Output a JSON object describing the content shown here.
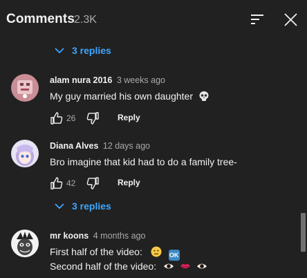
{
  "header": {
    "title": "Comments",
    "count": "2.3K",
    "sort_icon": "sort-icon",
    "close_icon": "close-icon"
  },
  "threads": [
    {
      "replies_label": "3 replies"
    },
    {
      "author": "alam nura 2016",
      "time": "3 weeks ago",
      "text": "My guy married his own daughter",
      "emoji": "skull",
      "likes": "26",
      "reply_label": "Reply"
    },
    {
      "author": "Diana Alves",
      "time": "12 days ago",
      "text": "Bro imagine that kid had to do a family tree-",
      "likes": "42",
      "reply_label": "Reply",
      "replies_label": "3 replies"
    },
    {
      "author": "mr koons",
      "time": "4 months ago",
      "line1": "First half of the video:",
      "line1_emojis": [
        "neutral-face",
        "ok-button"
      ],
      "ok_text": "OK",
      "line2": "Second half of the video:",
      "line2_emojis": [
        "eye",
        "lips",
        "eye"
      ]
    }
  ],
  "colors": {
    "background": "#212121",
    "accent": "#3ea6ff",
    "secondary_text": "#aaaaaa",
    "primary_text": "#f1f1f1"
  }
}
